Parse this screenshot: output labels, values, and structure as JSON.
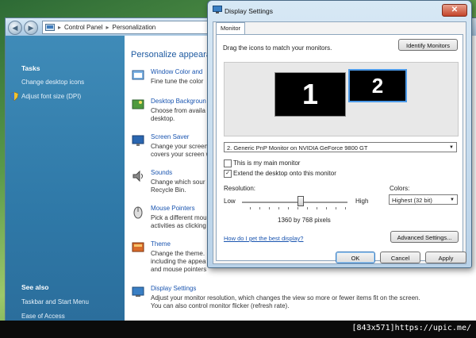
{
  "control_panel": {
    "breadcrumb": [
      "Control Panel",
      "Personalization"
    ],
    "sidebar": {
      "tasks_heading": "Tasks",
      "tasks": [
        "Change desktop icons",
        "Adjust font size (DPI)"
      ],
      "see_also_heading": "See also",
      "see_also": [
        "Taskbar and Start Menu",
        "Ease of Access"
      ]
    },
    "main": {
      "title": "Personalize appeara",
      "items": [
        {
          "icon": "window-color-icon",
          "link": "Window Color and",
          "desc": "Fine tune the color"
        },
        {
          "icon": "desktop-background-icon",
          "link": "Desktop Backgroun",
          "desc": "Choose from availa\ndesktop."
        },
        {
          "icon": "screen-saver-icon",
          "link": "Screen Saver",
          "desc": "Change your screen\ncovers your screen w"
        },
        {
          "icon": "sounds-icon",
          "link": "Sounds",
          "desc": "Change which sour\nRecycle Bin."
        },
        {
          "icon": "mouse-pointers-icon",
          "link": "Mouse Pointers",
          "desc": "Pick a different mou\nactivities as clicking"
        },
        {
          "icon": "theme-icon",
          "link": "Theme",
          "desc": "Change the theme.\nincluding the appea\nand mouse pointers"
        },
        {
          "icon": "display-settings-icon",
          "link": "Display Settings",
          "desc": "Adjust your monitor resolution, which changes the view so more or fewer items fit on the screen.\nYou can also control monitor flicker (refresh rate)."
        }
      ]
    }
  },
  "dialog": {
    "title": "Display Settings",
    "tab": "Monitor",
    "instruction": "Drag the icons to match your monitors.",
    "identify_button": "Identify Monitors",
    "monitors": [
      "1",
      "2"
    ],
    "monitor_select": "2. Generic PnP Monitor on NVIDIA GeForce 9800 GT",
    "main_monitor_checkbox": "This is my main monitor",
    "main_monitor_checked": false,
    "extend_checkbox": "Extend the desktop onto this monitor",
    "extend_checked": true,
    "resolution_label": "Resolution:",
    "low_label": "Low",
    "high_label": "High",
    "resolution_value": "1360 by 768 pixels",
    "resolution_level": 0.55,
    "colors_label": "Colors:",
    "colors_value": "Highest (32 bit)",
    "help_link": "How do I get the best display?",
    "advanced_button": "Advanced Settings...",
    "ok_button": "OK",
    "cancel_button": "Cancel",
    "apply_button": "Apply"
  },
  "watermark": "[843x571]https://upic.me/"
}
